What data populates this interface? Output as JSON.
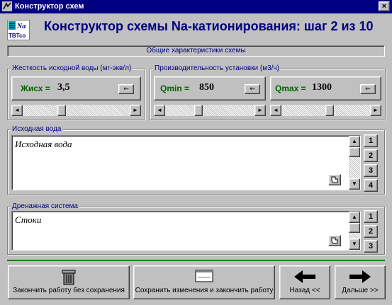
{
  "window": {
    "title": "Конструктор схем",
    "close_glyph": "×"
  },
  "header": {
    "logo_text_top": "Na",
    "logo_text_bottom": "TBTco",
    "title": "Конструктор схемы Na-катионирования: шаг 2 из 10"
  },
  "general_label": "Общие характеристики схемы",
  "hardness": {
    "group_label": "Жесткость исходной воды (мг-экв/л)",
    "label": "Жисх =",
    "value": "3,5",
    "slider_fraction": 0.35
  },
  "capacity": {
    "group_label": "Производительность установки (м3/ч)",
    "min_label": "Qmin =",
    "min_value": "850",
    "min_slider_fraction": 0.36,
    "max_label": "Qmax =",
    "max_value": "1300",
    "max_slider_fraction": 0.55
  },
  "source_water": {
    "group_label": "Исходная вода",
    "text": "Исходная вода",
    "buttons": [
      "1",
      "2",
      "3",
      "4"
    ]
  },
  "drainage": {
    "group_label": "Дренажная система",
    "text": "Стоки",
    "buttons": [
      "1",
      "2",
      "3"
    ]
  },
  "footer": {
    "exit_no_save": "Закончить работу без сохранения",
    "save_exit": "Сохранить изменения и закончить работу",
    "back": "Назад <<",
    "next": "Дальше >>"
  },
  "icons": {
    "arrow_left_small": "⇐",
    "scroll_left": "◄",
    "scroll_right": "►",
    "scroll_up": "▲",
    "scroll_down": "▼"
  }
}
